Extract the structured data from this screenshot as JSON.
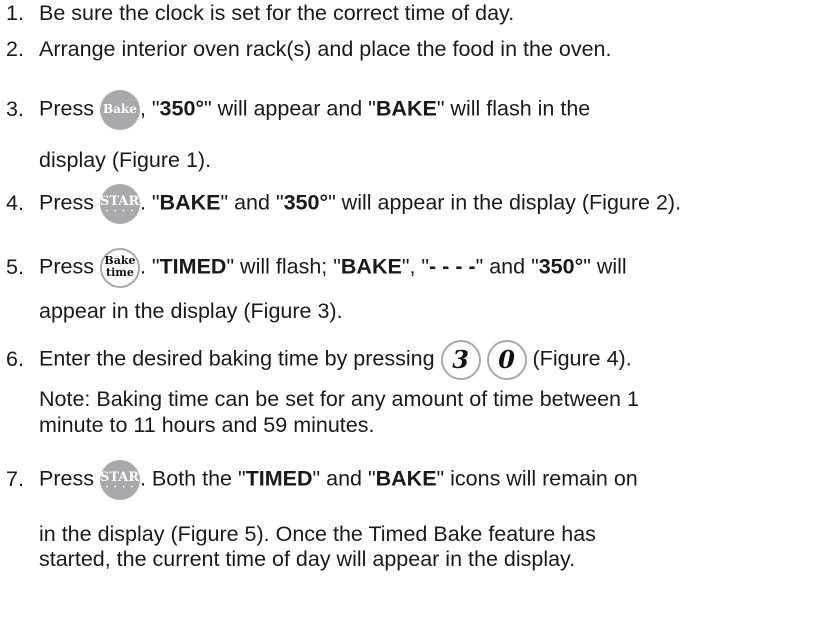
{
  "steps": [
    {
      "num": "1.",
      "text": "Be sure the clock is set for the correct time of day."
    },
    {
      "num": "2.",
      "text": "Arrange interior oven rack(s) and place the food in the oven."
    },
    {
      "num": "3.",
      "press": "Press",
      "btn_label": "Bake",
      "sep": ", ",
      "q1": "\"",
      "v1": "350°",
      "q2": "\"",
      "mid1": " will appear and ",
      "q3": "\"",
      "v2": "BAKE",
      "q4": "\"",
      "tail": " will flash in the",
      "line2": "display (Figure 1)."
    },
    {
      "num": "4.",
      "press": "Press",
      "btn_label": "START",
      "btn_dots": "· · · ·",
      "sep": ". ",
      "q1": "\"",
      "v1": "BAKE",
      "q2": "\"",
      "mid1": " and ",
      "q3": "\"",
      "v2": "350°",
      "q4": "\"",
      "tail": " will appear in the display (Figure 2)."
    },
    {
      "num": "5.",
      "press": "Press",
      "btn_label1": "Bake",
      "btn_label2": "time",
      "sep": ". ",
      "q1": "\"",
      "v1": "TIMED",
      "q2": "\"",
      "mid1": " will flash; ",
      "q3": "\"",
      "v2": "BAKE",
      "q4": "\"",
      "mid2": ", ",
      "q5": "\"",
      "v3": "- - - -",
      "q6": "\"",
      "mid3": " and ",
      "q7": "\"",
      "v4": "350°",
      "q8": "\"",
      "tail": " will",
      "line2": "appear in the display (Figure 3)."
    },
    {
      "num": "6.",
      "text": "Enter the desired baking time by pressing",
      "digit1": "3",
      "digit2": "0",
      "tail": " (Figure 4).",
      "note1": "Note: Baking time can be set for any amount of time between 1",
      "note2": "minute to 11 hours and 59 minutes."
    },
    {
      "num": "7.",
      "press": "Press",
      "btn_label": "START",
      "btn_dots": "· · · ·",
      "sep": ". Both the ",
      "q1": "\"",
      "v1": "TIMED",
      "q2": "\"",
      "mid1": " and ",
      "q3": "\"",
      "v2": "BAKE",
      "q4": "\"",
      "tail": " icons will remain on",
      "line2": "in the display (Figure 5). Once the Timed Bake feature has",
      "line3": "started, the current time of day will appear in the display."
    }
  ],
  "colors": {
    "button_fill": "#a7a9ac",
    "text": "#1a1a1a"
  }
}
